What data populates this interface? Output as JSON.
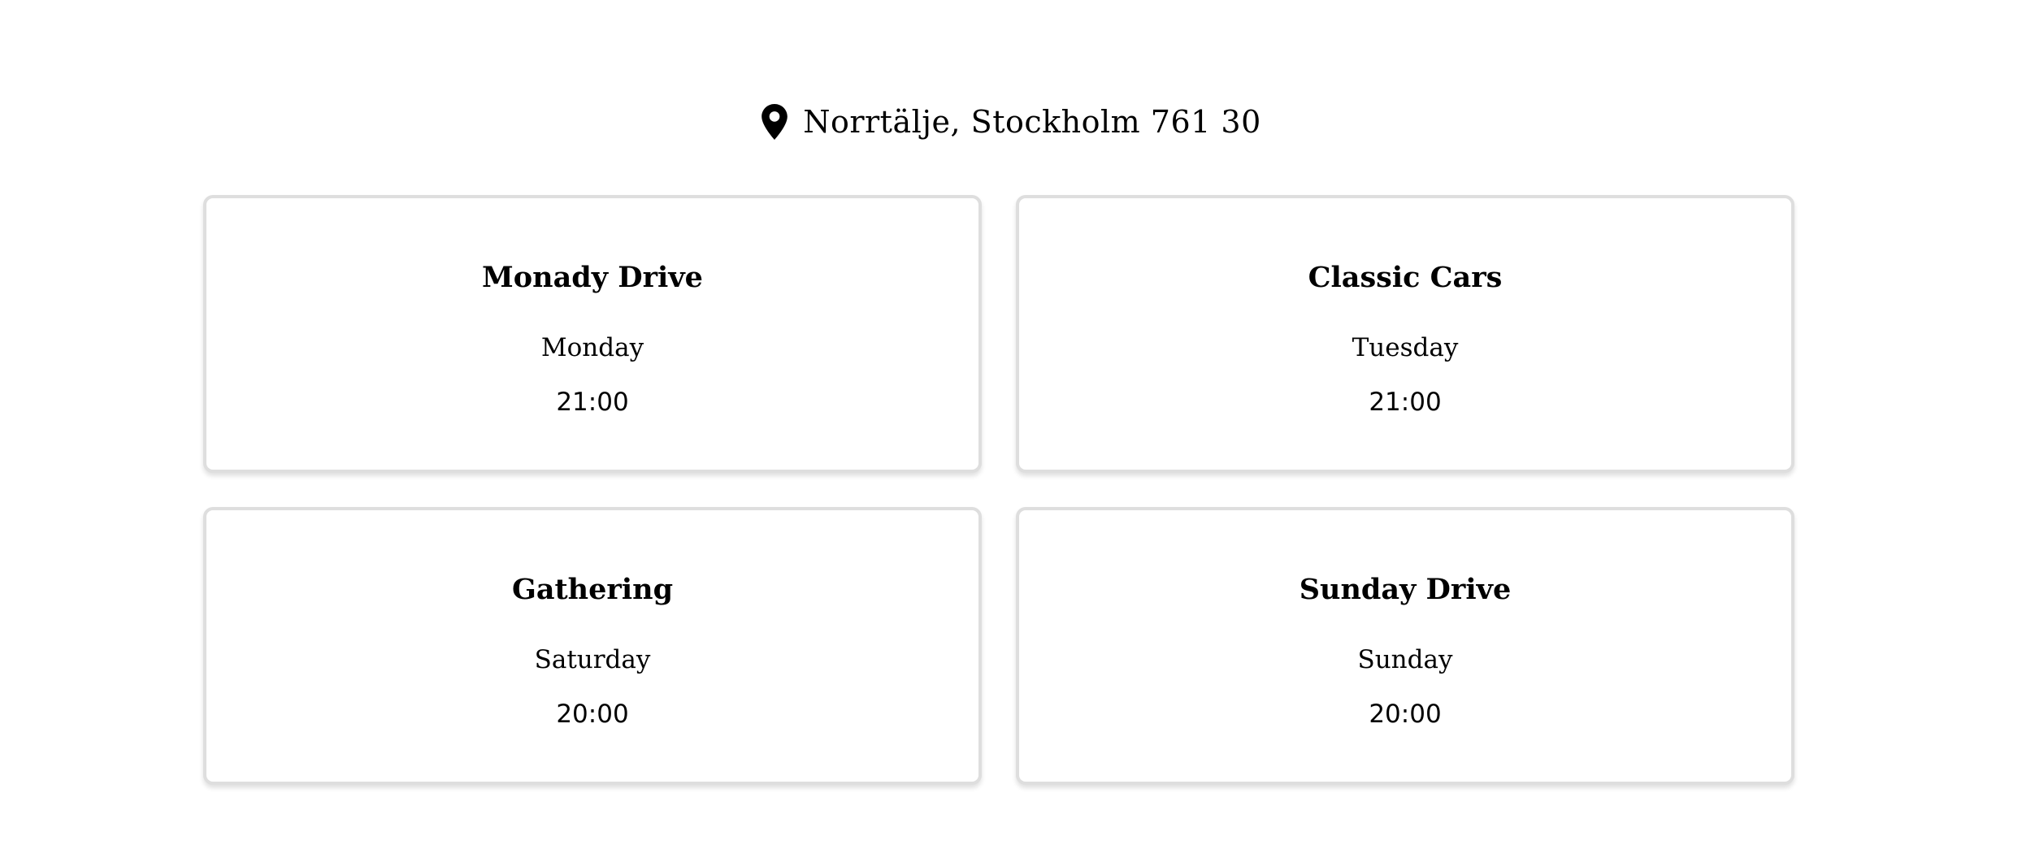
{
  "location": {
    "icon": "map-pin-icon",
    "address": "Norrtälje, Stockholm 761 30"
  },
  "events": [
    {
      "title": "Monady Drive",
      "day": "Monday",
      "time": "21:00"
    },
    {
      "title": "Classic Cars",
      "day": "Tuesday",
      "time": "21:00"
    },
    {
      "title": "Gathering",
      "day": "Saturday",
      "time": "20:00"
    },
    {
      "title": "Sunday Drive",
      "day": "Sunday",
      "time": "20:00"
    }
  ]
}
